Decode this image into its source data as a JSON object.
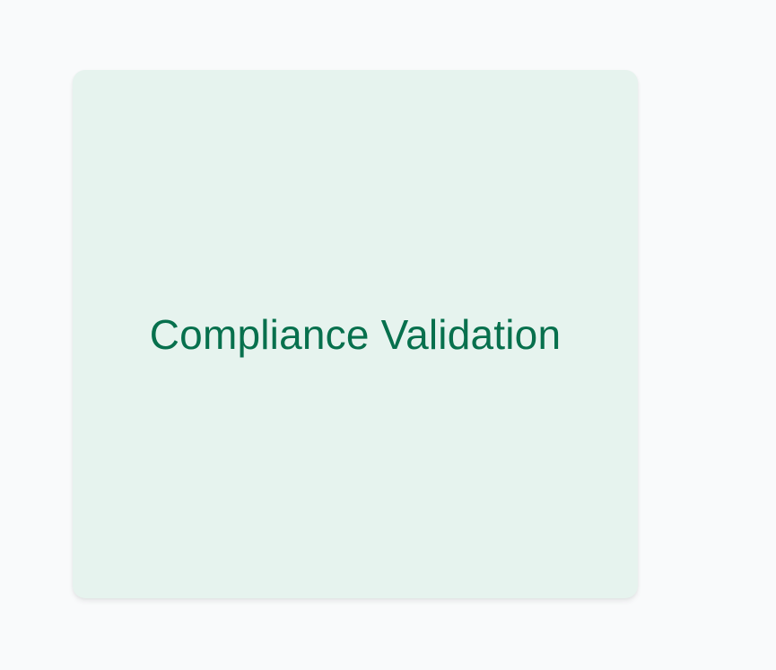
{
  "card": {
    "title": "Compliance Validation"
  },
  "colors": {
    "page_background": "#f9fafb",
    "card_background": "#e6f3ee",
    "title_text": "#07704d"
  }
}
